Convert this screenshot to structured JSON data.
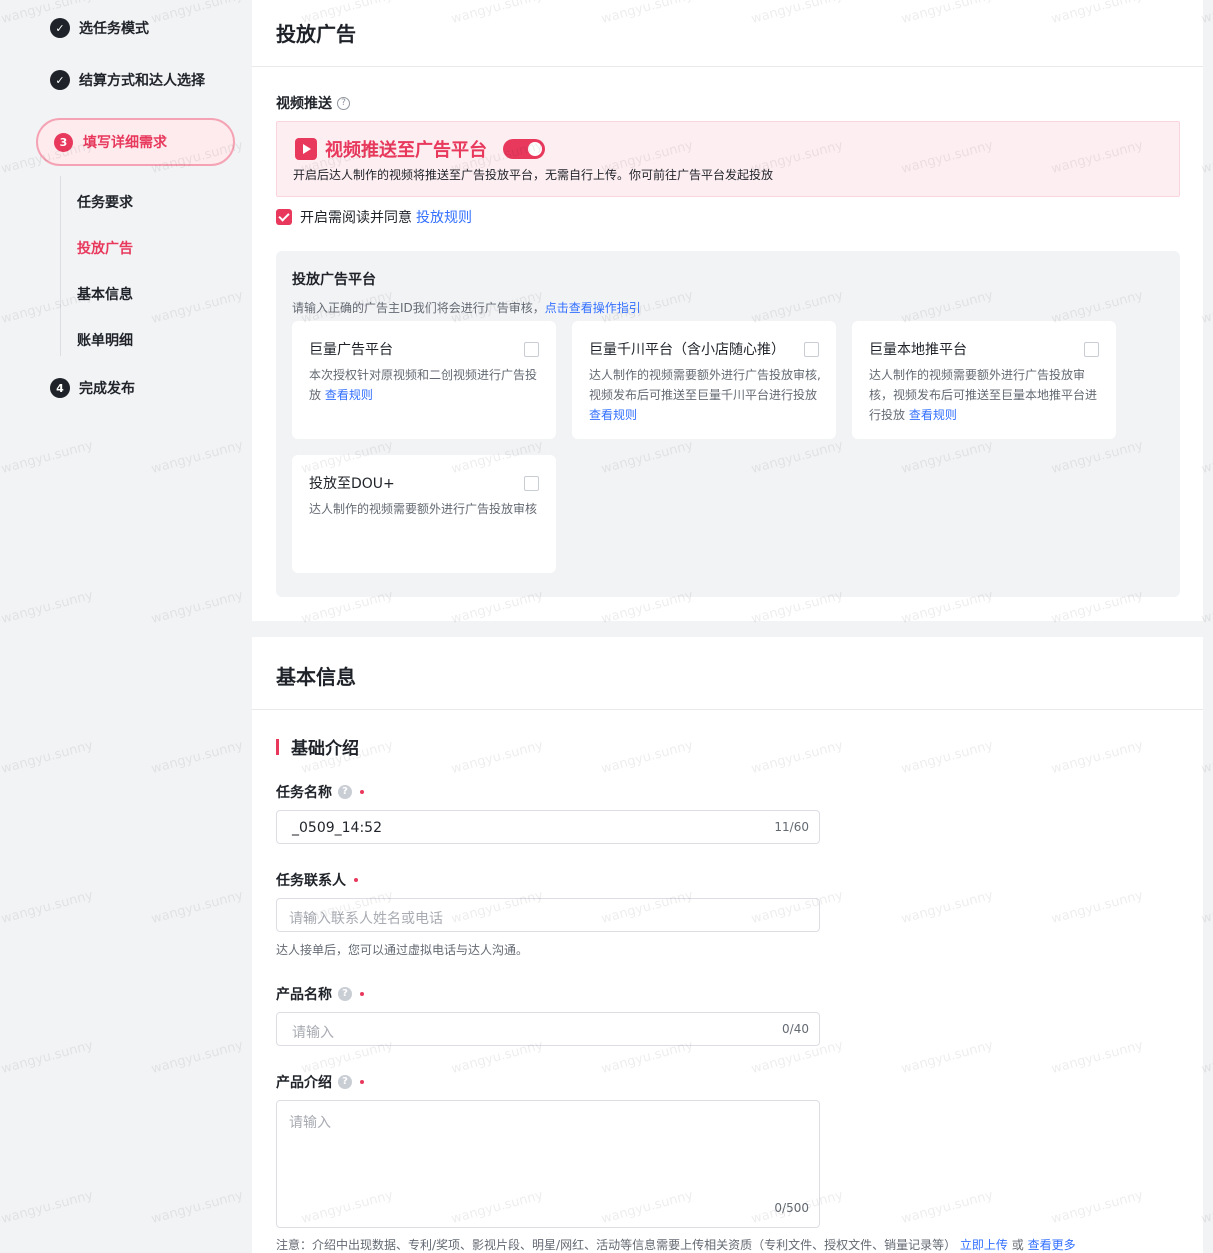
{
  "sidebar": {
    "steps_done": [
      "选任务模式",
      "结算方式和达人选择"
    ],
    "active_step": {
      "number": "3",
      "label": "填写详细需求"
    },
    "substeps": [
      "任务要求",
      "投放广告",
      "基本信息",
      "账单明细"
    ],
    "final_step": {
      "number": "4",
      "label": "完成发布"
    }
  },
  "ad_section": {
    "title": "投放广告",
    "video_push_label": "视频推送",
    "banner_title": "视频推送至广告平台",
    "banner_toggle_on": true,
    "banner_desc": "开启后达人制作的视频将推送至广告投放平台，无需自行上传。你可前往广告平台发起投放",
    "agree_text": "开启需阅读并同意",
    "agree_link": "投放规则",
    "platform_title": "投放广告平台",
    "platform_hint": "请输入正确的广告主ID我们将会进行广告审核，",
    "platform_hint_link": "点击查看操作指引",
    "platforms": [
      {
        "title": "巨量广告平台",
        "desc": "本次授权针对原视频和二创视频进行广告投放",
        "link": "查看规则"
      },
      {
        "title": "巨量千川平台（含小店随心推）",
        "desc": "达人制作的视频需要额外进行广告投放审核, 视频发布后可推送至巨量千川平台进行投放",
        "link": "查看规则"
      },
      {
        "title": "巨量本地推平台",
        "desc": "达人制作的视频需要额外进行广告投放审核，视频发布后可推送至巨量本地推平台进行投放",
        "link": "查看规则"
      },
      {
        "title": "投放至DOU+",
        "desc": "达人制作的视频需要额外进行广告投放审核",
        "link": ""
      }
    ]
  },
  "basic_section": {
    "title": "基本信息",
    "subsection": "基础介绍",
    "task_name": {
      "label": "任务名称",
      "value": "_0509_14:52",
      "counter": "11/60"
    },
    "contact": {
      "label": "任务联系人",
      "placeholder": "请输入联系人姓名或电话",
      "help": "达人接单后，您可以通过虚拟电话与达人沟通。"
    },
    "product_name": {
      "label": "产品名称",
      "placeholder": "请输入",
      "counter": "0/40"
    },
    "product_intro": {
      "label": "产品介绍",
      "placeholder": "请输入",
      "counter": "0/500"
    },
    "note": "注意：介绍中出现数据、专利/奖项、影视片段、明星/网红、活动等信息需要上传相关资质（专利文件、授权文件、销量记录等）",
    "note_link1": "立即上传",
    "note_or": "或",
    "note_link2": "查看更多"
  },
  "watermark": "wangyu.sunny",
  "colors": {
    "accent": "#e8395d",
    "link": "#3370ff"
  }
}
